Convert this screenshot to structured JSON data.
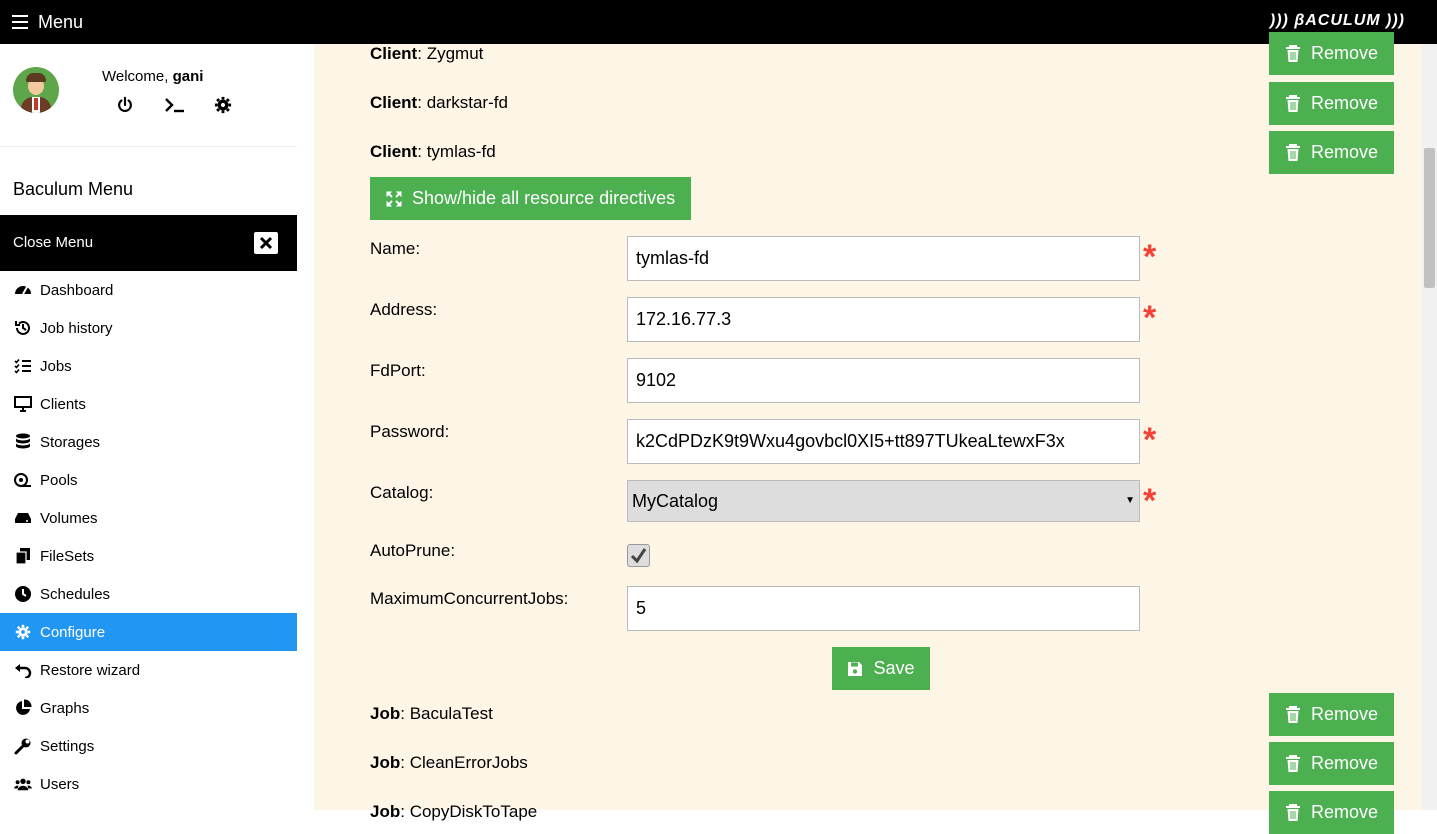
{
  "topbar": {
    "menu_label": "Menu",
    "brand": "))) βACULUM )))"
  },
  "user": {
    "welcome_prefix": "Welcome, ",
    "username": "gani"
  },
  "sidebar": {
    "title": "Baculum Menu",
    "close_label": "Close Menu",
    "items": [
      {
        "label": "Dashboard",
        "icon": "gauge-icon"
      },
      {
        "label": "Job history",
        "icon": "history-icon"
      },
      {
        "label": "Jobs",
        "icon": "tasks-icon"
      },
      {
        "label": "Clients",
        "icon": "desktop-icon"
      },
      {
        "label": "Storages",
        "icon": "database-icon"
      },
      {
        "label": "Pools",
        "icon": "tape-icon"
      },
      {
        "label": "Volumes",
        "icon": "hdd-icon"
      },
      {
        "label": "FileSets",
        "icon": "copy-icon"
      },
      {
        "label": "Schedules",
        "icon": "clock-icon"
      },
      {
        "label": "Configure",
        "icon": "gear-icon"
      },
      {
        "label": "Restore wizard",
        "icon": "undo-icon"
      },
      {
        "label": "Graphs",
        "icon": "pie-chart-icon"
      },
      {
        "label": "Settings",
        "icon": "wrench-icon"
      },
      {
        "label": "Users",
        "icon": "users-icon"
      }
    ],
    "active": "Configure"
  },
  "resources_top": [
    {
      "type": "Client",
      "name": "Zygmut"
    },
    {
      "type": "Client",
      "name": "darkstar-fd"
    },
    {
      "type": "Client",
      "name": "tymlas-fd"
    }
  ],
  "remove_label": "Remove",
  "toggle_label": "Show/hide all resource directives",
  "form": {
    "name_label": "Name:",
    "name_value": "tymlas-fd",
    "address_label": "Address:",
    "address_value": "172.16.77.3",
    "fdport_label": "FdPort:",
    "fdport_value": "9102",
    "password_label": "Password:",
    "password_value": "k2CdPDzK9t9Wxu4govbcl0XI5+tt897TUkeaLtewxF3x",
    "catalog_label": "Catalog:",
    "catalog_value": "MyCatalog",
    "autoprune_label": "AutoPrune:",
    "autoprune_checked": true,
    "maxjobs_label": "MaximumConcurrentJobs:",
    "maxjobs_value": "5",
    "required_mark": "*",
    "save_label": "Save"
  },
  "resources_bottom": [
    {
      "type": "Job",
      "name": "BaculaTest"
    },
    {
      "type": "Job",
      "name": "CleanErrorJobs"
    },
    {
      "type": "Job",
      "name": "CopyDiskToTape"
    }
  ],
  "colors": {
    "accent_green": "#4caf50",
    "active_blue": "#2196f3",
    "required_red": "#f44336",
    "panel_bg": "#fdf5e6"
  }
}
